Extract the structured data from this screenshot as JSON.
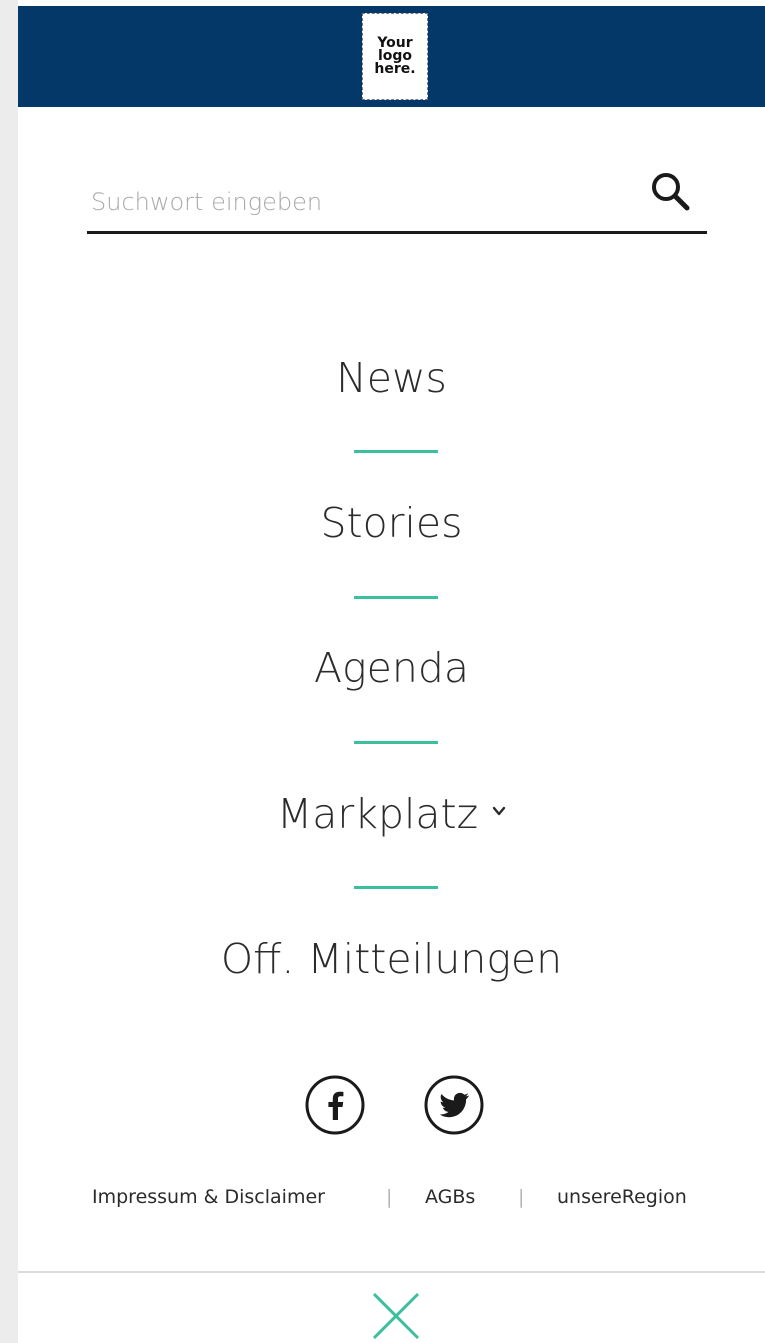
{
  "header": {
    "logo_text": "Your\nlogo\nhere.",
    "background": "#043869"
  },
  "search": {
    "placeholder": "Suchwort eingeben",
    "value": "",
    "icon": "search-icon"
  },
  "nav": {
    "items": [
      {
        "label": "News"
      },
      {
        "label": "Stories"
      },
      {
        "label": "Agenda"
      },
      {
        "label": "Markplatz",
        "icon": "chevron-down-icon"
      },
      {
        "label": "Off. Mitteilungen"
      }
    ],
    "divider_color": "#3bbf9c"
  },
  "social": {
    "facebook_icon": "facebook-icon",
    "twitter_icon": "twitter-icon"
  },
  "footer": {
    "links": [
      {
        "label": "Impressum & Disclaimer"
      },
      {
        "label": "AGBs"
      },
      {
        "label": "unsereRegion"
      }
    ],
    "separator": "|"
  },
  "close": {
    "icon": "close-icon",
    "color": "#3bbf9c"
  }
}
